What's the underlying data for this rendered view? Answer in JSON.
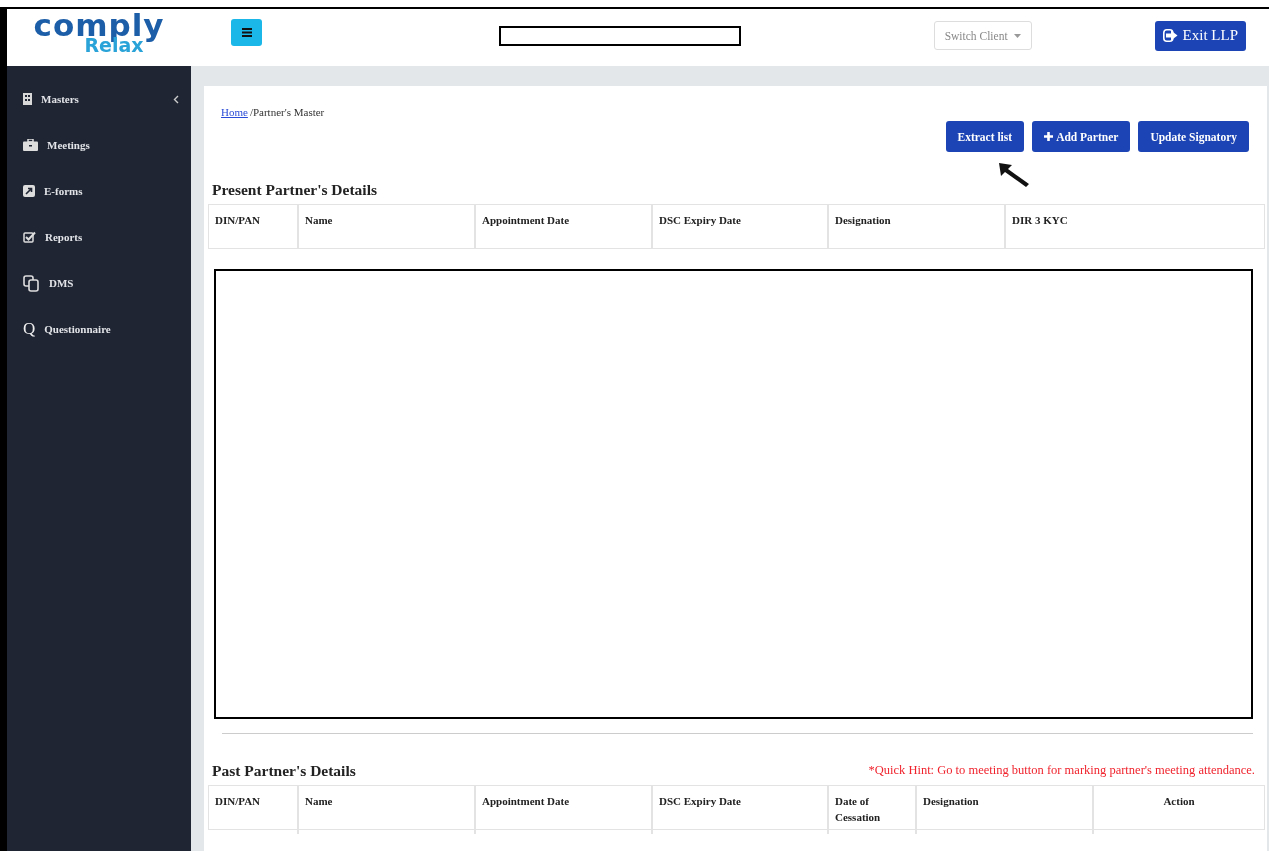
{
  "logo": {
    "primary": "comply",
    "secondary": "Relax"
  },
  "sidebar": {
    "items": [
      {
        "kind": "building",
        "label": "Masters",
        "has_submenu": true
      },
      {
        "kind": "briefcase",
        "label": "Meetings",
        "has_submenu": false
      },
      {
        "kind": "external",
        "label": "E-forms",
        "has_submenu": false
      },
      {
        "kind": "check",
        "label": "Reports",
        "has_submenu": false
      },
      {
        "kind": "copy",
        "label": "DMS",
        "has_submenu": false
      },
      {
        "kind": "letter",
        "glyph": "Q",
        "label": "Questionnaire",
        "has_submenu": false
      }
    ]
  },
  "header": {
    "switch_client": {
      "label": "Switch Client"
    },
    "exit_button": {
      "label": "Exit LLP"
    }
  },
  "breadcrumb": [
    {
      "label": "Home",
      "link": true
    },
    {
      "label": "/Partner's Master",
      "link": false
    }
  ],
  "actions": [
    {
      "label": "Extract list",
      "kind": "plain"
    },
    {
      "label": "Add Partner",
      "kind": "add"
    },
    {
      "label": "Update Signatory",
      "kind": "plain"
    }
  ],
  "present_partners": {
    "title": "Present Partner's Details",
    "columns": [
      "DIN/PAN",
      "Name",
      "Appointment Date",
      "DSC Expiry Date",
      "Designation",
      "DIR 3 KYC"
    ]
  },
  "past_partners": {
    "title": "Past Partner's Details",
    "hint": "*Quick Hint: Go to meeting button for marking partner's meeting attendance.",
    "columns": [
      "DIN/PAN",
      "Name",
      "Appointment Date",
      "DSC Expiry Date",
      "Date of Cessation",
      "Designation",
      "Action"
    ]
  }
}
